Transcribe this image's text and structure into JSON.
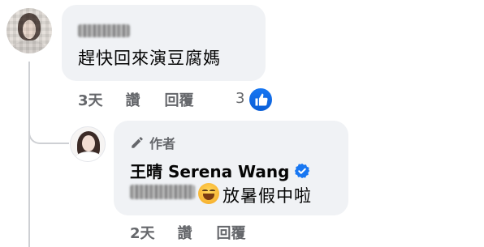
{
  "comment": {
    "text": "趕快回來演豆腐媽",
    "time": "3天",
    "like_label": "讚",
    "reply_label": "回覆",
    "like_count": "3"
  },
  "reply": {
    "author_badge": "作者",
    "author_name": "王晴 Serena Wang",
    "text": "放暑假中啦",
    "time": "2天",
    "like_label": "讚",
    "reply_label": "回覆"
  },
  "icons": {
    "author": "pencil-icon",
    "verified": "verified-badge-icon",
    "reaction": "thumbs-up-icon",
    "emoji": "grinning-emoji-icon"
  },
  "colors": {
    "bubble": "#f0f2f5",
    "secondary_text": "#65676b",
    "accent": "#1877f2",
    "thread_line": "#ced0d4"
  }
}
